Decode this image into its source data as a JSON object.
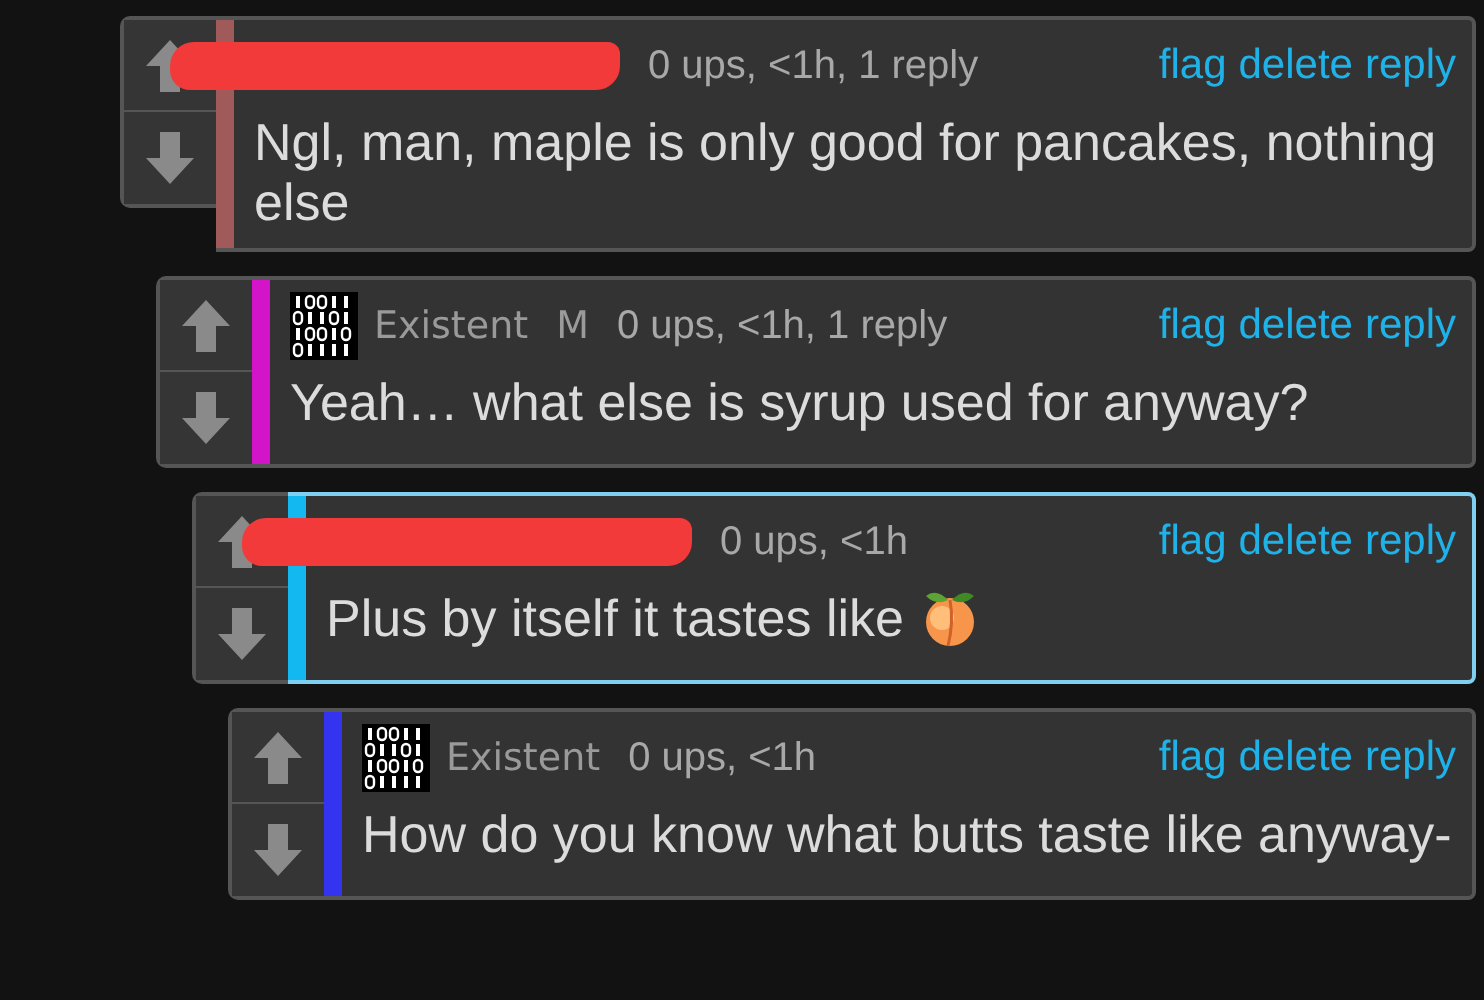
{
  "thread": [
    {
      "redacted": true,
      "meta": "0 ups, <1h, 1 reply",
      "color": "#a05a5a",
      "highlighted": false,
      "text": "Ngl, man, maple is only good for pancakes, nothing else",
      "icon_after_text": false,
      "actions": [
        "flag",
        "delete",
        "reply"
      ],
      "children": [
        {
          "redacted": false,
          "author": "Existent",
          "badge": "M",
          "meta": "0 ups, <1h, 1 reply",
          "color": "#d414c8",
          "highlighted": false,
          "text": "Yeah… what else is syrup used for anyway?",
          "icon_after_text": false,
          "actions": [
            "flag",
            "delete",
            "reply"
          ],
          "children": [
            {
              "redacted": true,
              "meta": "0 ups, <1h",
              "color": "#14b8f0",
              "highlighted": true,
              "text": "Plus by itself it tastes like",
              "icon_after_text": true,
              "actions": [
                "flag",
                "delete",
                "reply"
              ],
              "children": [
                {
                  "redacted": false,
                  "author": "Existent",
                  "meta": "0 ups, <1h",
                  "color": "#3434f0",
                  "highlighted": false,
                  "text": "How do you know what butts taste like anyway-",
                  "icon_after_text": false,
                  "actions": [
                    "flag",
                    "delete",
                    "reply"
                  ]
                }
              ]
            }
          ]
        }
      ]
    }
  ]
}
